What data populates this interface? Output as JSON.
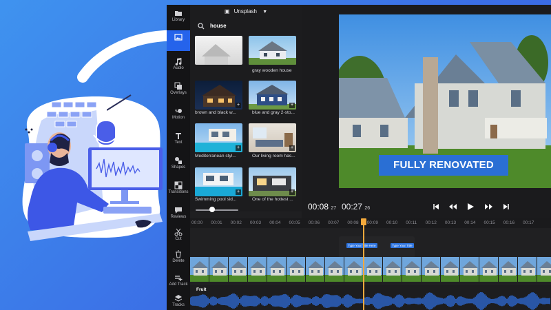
{
  "colors": {
    "accent": "#2563eb",
    "background": "#3b6fe6",
    "playhead": "#f4a93c"
  },
  "sidebar": {
    "items": [
      {
        "label": "Library",
        "icon": "folder-icon"
      },
      {
        "label": "",
        "icon": "images-icon",
        "active": true
      },
      {
        "label": "Audio",
        "icon": "music-note-icon"
      },
      {
        "label": "Overlays",
        "icon": "overlays-icon"
      },
      {
        "label": "Motion",
        "icon": "motion-icon"
      },
      {
        "label": "Text",
        "icon": "text-icon"
      },
      {
        "label": "Shapes",
        "icon": "shapes-icon"
      },
      {
        "label": "Transitions",
        "icon": "transitions-icon"
      },
      {
        "label": "Reviews",
        "icon": "chat-bubble-icon"
      },
      {
        "label": "Cut",
        "icon": "scissors-icon"
      },
      {
        "label": "Delete",
        "icon": "trash-icon"
      },
      {
        "label": "Add Track",
        "icon": "add-track-icon"
      },
      {
        "label": "Tracks",
        "icon": "layers-icon"
      }
    ]
  },
  "media_panel": {
    "source_label": "Unsplash",
    "search_query": "house",
    "results": [
      {
        "label": ""
      },
      {
        "label": "gray wooden house"
      },
      {
        "label": "brown and black w..."
      },
      {
        "label": "blue and gray 2-sto..."
      },
      {
        "label": "Mediterranean styl..."
      },
      {
        "label": "Our living room has..."
      },
      {
        "label": "Swimming pool sid..."
      },
      {
        "label": "One of the hottest ..."
      }
    ]
  },
  "preview": {
    "title_text": "FULLY RENOVATED"
  },
  "transport": {
    "current_time": "00:08",
    "current_frames": "27",
    "total_time": "00:27",
    "total_frames": "26"
  },
  "timeline": {
    "ticks": [
      "00:00",
      "00:01",
      "00:02",
      "00:03",
      "00:04",
      "00:05",
      "00:06",
      "00:07",
      "00:08",
      "00:09",
      "00:10",
      "00:11",
      "00:12",
      "00:13",
      "00:14",
      "00:15",
      "00:16",
      "00:17"
    ],
    "title_clip_1": "Type Your Title Here",
    "title_clip_2": "Type Your Title",
    "audio_track_label": "Fruit"
  }
}
